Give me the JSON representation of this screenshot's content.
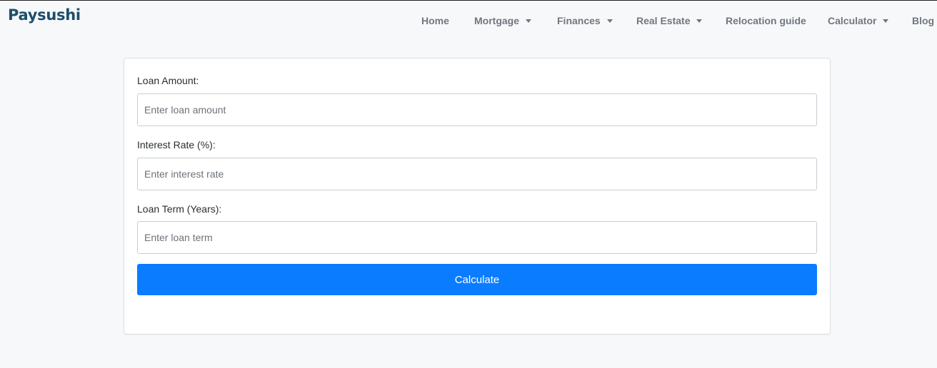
{
  "brand": {
    "name": "Paysushi",
    "color": "#1e4d6b"
  },
  "nav": {
    "items": [
      {
        "label": "Home",
        "has_dropdown": false
      },
      {
        "label": "Mortgage",
        "has_dropdown": true
      },
      {
        "label": "Finances",
        "has_dropdown": true
      },
      {
        "label": "Real Estate",
        "has_dropdown": true
      },
      {
        "label": "Relocation guide",
        "has_dropdown": false
      },
      {
        "label": "Calculator",
        "has_dropdown": true
      },
      {
        "label": "Blog",
        "has_dropdown": false
      }
    ]
  },
  "form": {
    "loan_amount": {
      "label": "Loan Amount:",
      "value": "",
      "placeholder": "Enter loan amount"
    },
    "interest_rate": {
      "label": "Interest Rate (%):",
      "value": "",
      "placeholder": "Enter interest rate"
    },
    "loan_term": {
      "label": "Loan Term (Years):",
      "value": "",
      "placeholder": "Enter loan term"
    },
    "submit_label": "Calculate"
  },
  "colors": {
    "accent": "#0a7cff",
    "background": "#f7f8fa",
    "nav_text": "#707780"
  }
}
